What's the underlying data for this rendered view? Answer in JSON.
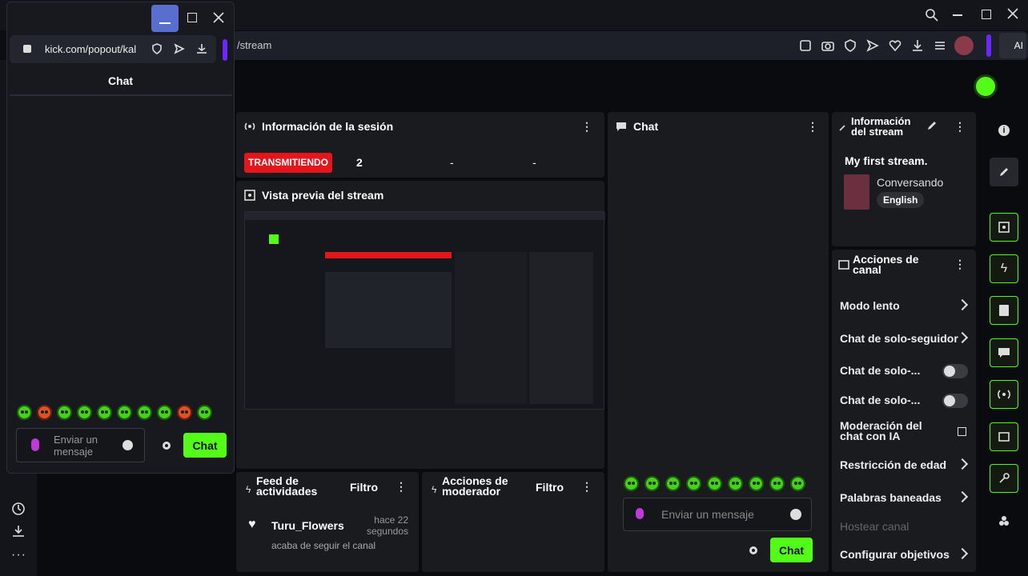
{
  "browser": {
    "url": "kick.com/popout/kal",
    "url_right": "/stream",
    "ai_label": "AI"
  },
  "popup": {
    "title": "Chat",
    "input_placeholder": "Enviar un mensaje",
    "send_label": "Chat"
  },
  "session": {
    "title": "Información de la sesión",
    "status": "TRANSMITIENDO",
    "viewers": "2",
    "stat2": "-",
    "stat3": "-"
  },
  "preview": {
    "title": "Vista previa del stream"
  },
  "chat": {
    "title": "Chat",
    "input_placeholder": "Enviar un mensaje",
    "send_label": "Chat"
  },
  "stream_info": {
    "title": "Información del stream",
    "stream_title": "My first stream.",
    "category": "Conversando",
    "language": "English"
  },
  "activity": {
    "title": "Feed de actividades",
    "filter": "Filtro",
    "user": "Turu_Flowers",
    "time": "hace 22 segundos",
    "action": "acaba de seguir el canal"
  },
  "mod_actions": {
    "title": "Acciones de moderador",
    "filter": "Filtro"
  },
  "channel_actions": {
    "title": "Acciones de canal",
    "items": [
      "Modo lento",
      "Chat de solo-seguidor",
      "Chat de solo-...",
      "Chat de solo-...",
      "Moderación del chat con IA",
      "Restricción de edad",
      "Palabras baneadas",
      "Hostear canal",
      "Configurar objetivos"
    ]
  },
  "colors": {
    "accent": "#53fc18",
    "live": "#e4161c"
  }
}
